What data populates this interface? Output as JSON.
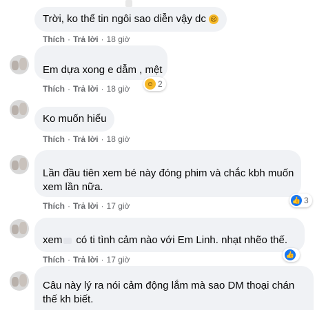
{
  "comments": [
    {
      "text": "Trời, ko thể tin ngôi sao diễn vậy dc",
      "like": "Thích",
      "reply": "Trả lời",
      "time": "18 giờ"
    },
    {
      "text": "Em dựa xong e dẫm , mệt",
      "like": "Thích",
      "reply": "Trả lời",
      "time": "18 giờ",
      "reaction_count": "2"
    },
    {
      "text": "Ko muốn hiểu",
      "like": "Thích",
      "reply": "Trả lời",
      "time": "18 giờ"
    },
    {
      "line1": "Lần đầu tiên xem bé này đóng phim và chắc kbh muốn",
      "line2": "xem lần nữa.",
      "like": "Thích",
      "reply": "Trả lời",
      "time": "17 giờ",
      "reaction_count": "3"
    },
    {
      "text_prefix": "xem",
      "text_rest": "có ti tình cảm nào với Em Linh. nhạt nhẽo thế.",
      "like": "Thích",
      "reply": "Trả lời",
      "time": "17 giờ",
      "reaction_count": ""
    },
    {
      "line1": "Câu này lý ra nói cảm động lắm mà sao DM thoại chán",
      "line2": "thế kh biết."
    }
  ],
  "icons": {
    "like": "thumbs-up-icon",
    "haha": "haha-icon",
    "sad": "sad-face-icon"
  },
  "colors": {
    "like": "#1877f2",
    "bubble": "#f0f2f5",
    "meta": "#65676b"
  }
}
